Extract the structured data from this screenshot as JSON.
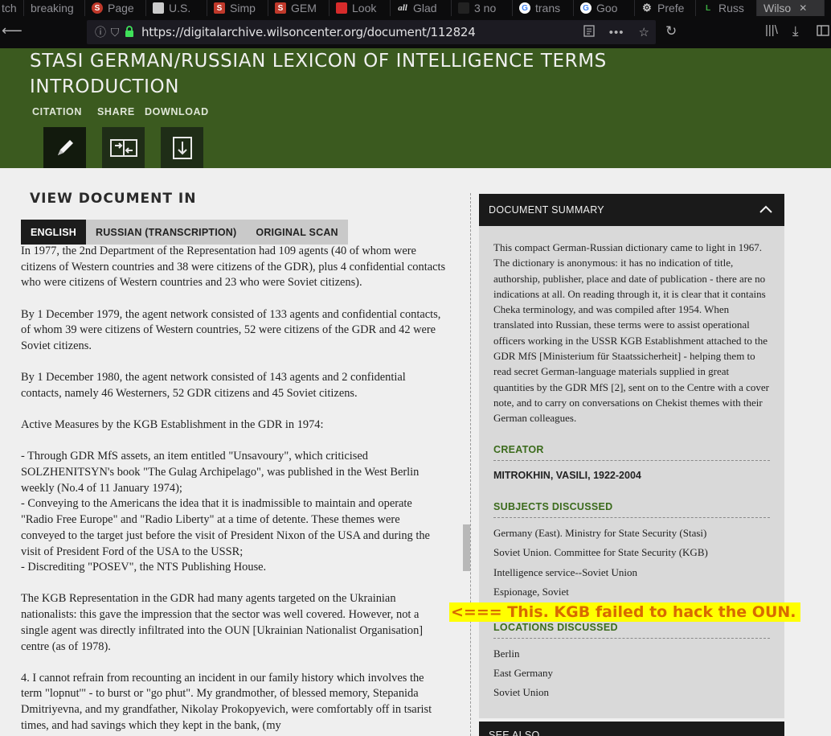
{
  "browser": {
    "tabs": [
      {
        "label": "tch",
        "fav": "",
        "color": "#555"
      },
      {
        "label": "breaking",
        "fav": "",
        "color": "#555"
      },
      {
        "label": "Page",
        "fav": "S",
        "color": "#c0392b"
      },
      {
        "label": "U.S.",
        "fav": "",
        "color": "#777"
      },
      {
        "label": "Simp",
        "fav": "S",
        "color": "#c0392b"
      },
      {
        "label": "GEM",
        "fav": "S",
        "color": "#c0392b"
      },
      {
        "label": "Look",
        "fav": "",
        "color": "#d62b2b"
      },
      {
        "label": "Glad",
        "fav": "all",
        "color": "#333"
      },
      {
        "label": "3 no",
        "fav": "",
        "color": "#444"
      },
      {
        "label": "trans",
        "fav": "G",
        "color": "#4285f4"
      },
      {
        "label": "Goo",
        "fav": "G",
        "color": "#4285f4"
      },
      {
        "label": "Prefe",
        "fav": "",
        "color": "#888"
      },
      {
        "label": "Russ",
        "fav": "L",
        "color": "#2e8b2e"
      },
      {
        "label": "Wilso",
        "fav": "",
        "color": "#555"
      }
    ],
    "url": "https://digitalarchive.wilsoncenter.org/document/112824"
  },
  "header": {
    "title_line1": "STASI GERMAN/RUSSIAN LEXICON OF INTELLIGENCE TERMS",
    "title_line2": "INTRODUCTION",
    "citation_label": "CITATION",
    "share_label": "SHARE",
    "download_label": "DOWNLOAD"
  },
  "view": {
    "heading": "VIEW DOCUMENT IN",
    "tabs": [
      "ENGLISH",
      "RUSSIAN (TRANSCRIPTION)",
      "ORIGINAL SCAN"
    ]
  },
  "body": {
    "p1": "In 1977, the 2nd Department of the Representation had 109 agents (40 of whom were citizens of Western countries and 38 were citizens of the GDR), plus 4 confidential contacts who were citizens of Western countries and 23 who were Soviet citizens).",
    "p2": "By 1 December 1979, the agent network consisted of 133 agents and confidential contacts, of whom 39 were citizens of Western countries, 52 were citizens of the GDR and 42 were Soviet citizens.",
    "p3": "By 1 December 1980, the agent network consisted of 143 agents and 2 confidential contacts, namely 46 Westerners, 52 GDR citizens and 45 Soviet citizens.",
    "p4": "Active Measures by the KGB Establishment in the GDR in 1974:",
    "p5": "- Through GDR MfS assets, an item entitled \"Unsavoury\", which criticised SOLZHENITSYN's book \"The Gulag Archipelago\", was published in the West Berlin weekly (No.4 of 11 January 1974);",
    "p6": "- Conveying to the Americans the idea that it is inadmissible to maintain and operate \"Radio Free Europe\" and \"Radio Liberty\" at a time of detente. These themes were conveyed to the target just before the visit of President Nixon of the USA and during the visit of President Ford of the USA to the USSR;",
    "p7": "- Discrediting \"POSEV\", the NTS Publishing House.",
    "p8": "The KGB Representation in the GDR had many agents targeted on the Ukrainian nationalists: this gave the impression that the sector was well covered. However, not a single agent was directly infiltrated into the OUN [Ukrainian Nationalist Organisation] centre (as of 1978).",
    "p9": "4. I cannot refrain from recounting an incident in our family history which involves the term \"lopnut'\" - to burst or \"go phut\". My grandmother, of blessed memory, Stepanida Dmitriyevna, and my grandfather, Nikolay Prokopyevich, were comfortably off in tsarist times, and had savings which they kept in the bank, (my"
  },
  "summary": {
    "heading": "DOCUMENT SUMMARY",
    "text": "This compact German-Russian dictionary came to light in 1967. The dictionary is anonymous: it has no indication of title, authorship, publisher, place and date of publication - there are no indications at all. On reading through it, it is clear that it contains Cheka terminology, and was compiled after 1954. When translated into Russian, these terms were to assist operational officers working in the USSR KGB Establishment attached to the GDR MfS [Ministerium für Staatssicherheit] - helping them to read secret German-language materials supplied in great quantities by the GDR MfS [2], sent on to the Centre with a cover note, and to carry on conversations on Chekist themes with their German colleagues.",
    "creator_label": "CREATOR",
    "creator": "MITROKHIN, VASILI, 1922-2004",
    "subjects_label": "SUBJECTS DISCUSSED",
    "subjects": [
      "Germany (East). Ministry for State Security (Stasi)",
      "Soviet Union. Committee for State Security (KGB)",
      "Intelligence service--Soviet Union",
      "Espionage, Soviet"
    ],
    "locations_label": "LOCATIONS DISCUSSED",
    "locations": [
      "Berlin",
      "East Germany",
      "Soviet Union"
    ],
    "see_also": "SEE ALSO"
  },
  "annotation": "<=== This.  KGB failed to hack the OUN."
}
